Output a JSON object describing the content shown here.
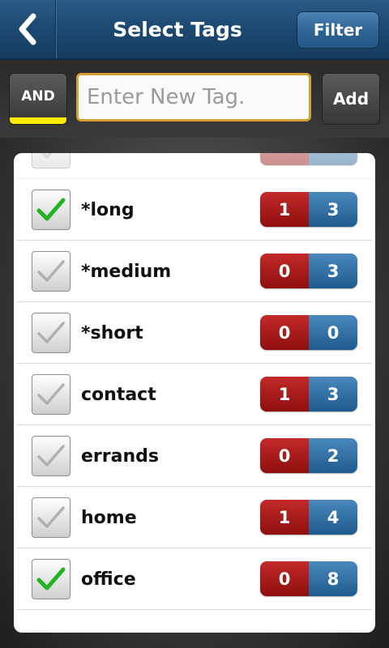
{
  "header": {
    "title": "Select Tags",
    "filter_label": "Filter"
  },
  "toolbar": {
    "and_label": "AND",
    "input_placeholder": "Enter New Tag.",
    "input_value": "",
    "add_label": "Add"
  },
  "tags": [
    {
      "label": "",
      "checked": false,
      "count_red": "",
      "count_blue": ""
    },
    {
      "label": "*long",
      "checked": true,
      "count_red": "1",
      "count_blue": "3"
    },
    {
      "label": "*medium",
      "checked": false,
      "count_red": "0",
      "count_blue": "3"
    },
    {
      "label": "*short",
      "checked": false,
      "count_red": "0",
      "count_blue": "0"
    },
    {
      "label": "contact",
      "checked": false,
      "count_red": "1",
      "count_blue": "3"
    },
    {
      "label": "errands",
      "checked": false,
      "count_red": "0",
      "count_blue": "2"
    },
    {
      "label": "home",
      "checked": false,
      "count_red": "1",
      "count_blue": "4"
    },
    {
      "label": "office",
      "checked": true,
      "count_red": "0",
      "count_blue": "8"
    }
  ],
  "colors": {
    "header": "#1d4a73",
    "and_indicator": "#ffeb00",
    "input_border": "#d4a12e",
    "count_red": "#a91a1a",
    "count_blue": "#2f6a9e",
    "check_green": "#22b322",
    "check_gray": "#b0b0b0"
  },
  "icons": {
    "back": "chevron-left-icon",
    "check": "checkmark-icon"
  }
}
